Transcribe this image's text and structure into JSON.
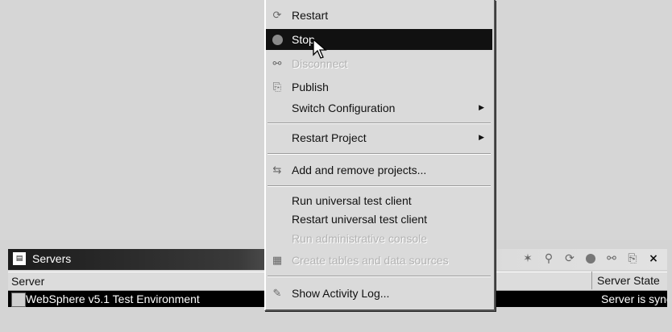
{
  "context_menu": {
    "items": [
      {
        "label": "Restart",
        "icon": "restart-icon",
        "enabled": true
      },
      {
        "label": "Stop",
        "icon": "stop-icon",
        "enabled": true,
        "highlighted": true
      },
      {
        "label": "Disconnect",
        "icon": "disconnect-icon",
        "enabled": false
      },
      {
        "label": "Publish",
        "icon": "publish-icon",
        "enabled": true
      },
      {
        "label": "Switch Configuration",
        "submenu": true,
        "enabled": true
      },
      {
        "label": "Restart Project",
        "submenu": true,
        "enabled": true
      },
      {
        "label": "Add and remove projects...",
        "icon": "add-remove-projects-icon",
        "enabled": true
      },
      {
        "label": "Run universal test client",
        "enabled": true
      },
      {
        "label": "Restart universal test client",
        "enabled": true
      },
      {
        "label": "Run administrative console",
        "enabled": false
      },
      {
        "label": "Create tables and data sources",
        "icon": "create-tables-icon",
        "enabled": false
      },
      {
        "label": "Show Activity Log...",
        "icon": "activity-log-icon",
        "enabled": true
      }
    ]
  },
  "servers_view": {
    "title": "Servers",
    "columns": {
      "server": "Server",
      "state": "Server State"
    },
    "rows": [
      {
        "server": "WebSphere v5.1 Test Environment",
        "state": "Server is synchronized"
      }
    ],
    "toolbar_icons": [
      "debug-icon",
      "profile-icon",
      "restart-icon",
      "stop-icon",
      "disconnect-icon",
      "publish-icon",
      "close-icon"
    ]
  },
  "colors": {
    "highlight": "#111111",
    "disabled_text": "#b3b3b3"
  }
}
